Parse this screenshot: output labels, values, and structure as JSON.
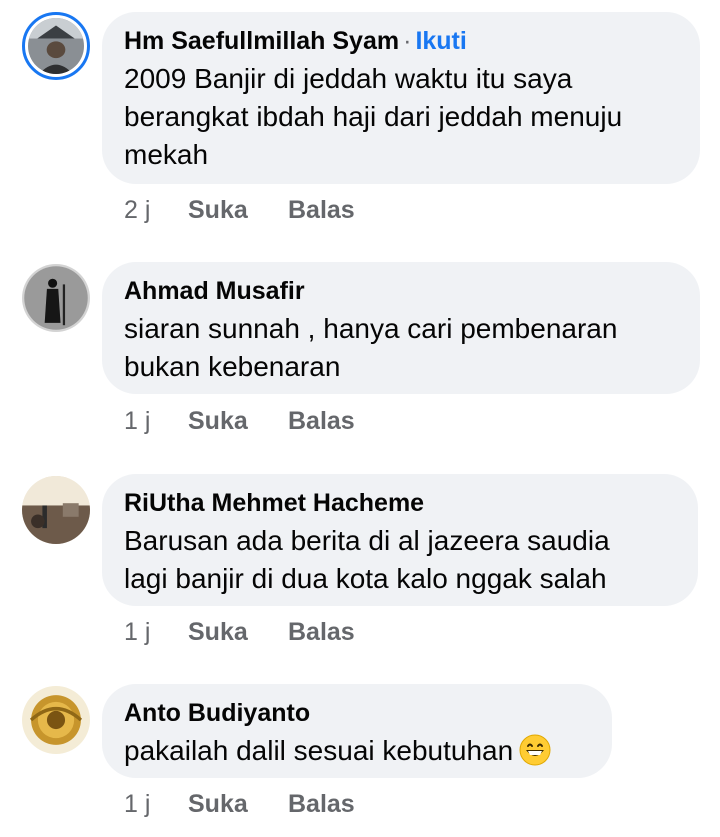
{
  "comments": [
    {
      "name": "Hm Saefullmillah Syam",
      "separator": "·",
      "follow_label": "Ikuti",
      "text": "2009 Banjir di jeddah waktu itu saya\nberangkat ibdah haji dari jeddah menuju\nmekah",
      "time": "2 j",
      "like_label": "Suka",
      "reply_label": "Balas"
    },
    {
      "name": "Ahmad Musafir",
      "text": "siaran sunnah , hanya cari pembenaran\nbukan kebenaran",
      "time": "1 j",
      "like_label": "Suka",
      "reply_label": "Balas"
    },
    {
      "name": "RiUtha Mehmet Hacheme",
      "text": "Barusan ada berita di al jazeera saudia\nlagi banjir di dua kota kalo nggak salah",
      "time": "1 j",
      "like_label": "Suka",
      "reply_label": "Balas"
    },
    {
      "name": "Anto Budiyanto",
      "text": "pakailah dalil sesuai kebutuhan",
      "emoji": "grinning-face-emoji",
      "time": "1 j",
      "like_label": "Suka",
      "reply_label": "Balas"
    }
  ],
  "colors": {
    "bubble_bg": "#f0f2f5",
    "meta_text": "#65676b",
    "follow_link": "#1877f2",
    "avatar_ring": "#1877f2"
  }
}
